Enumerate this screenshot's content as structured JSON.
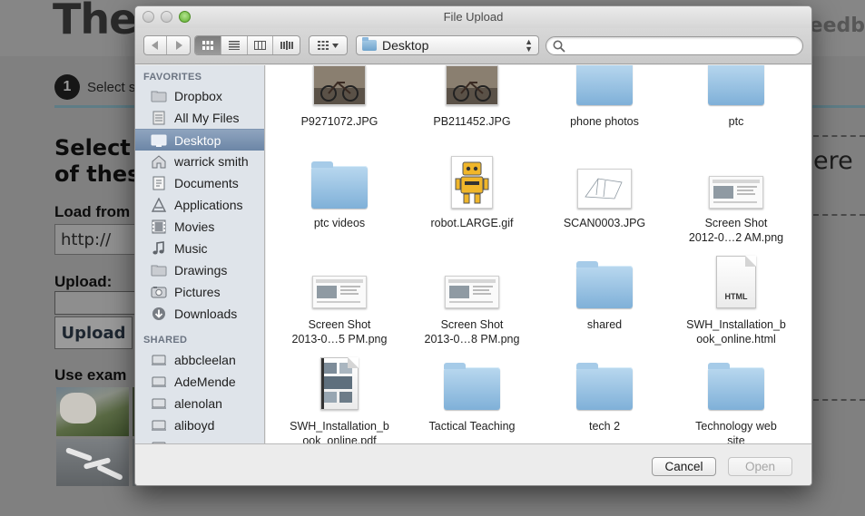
{
  "background_page": {
    "logo_text": "The",
    "feedback_text": "Feedb",
    "step_number": "1",
    "step_text": "Select s",
    "heading_line1": "Select",
    "heading_line2": "of thes",
    "right_text": "ere",
    "load_label": "Load from",
    "url_value": "http://",
    "upload_label": "Upload:",
    "upload_button": "Upload",
    "examples_label": "Use exam"
  },
  "dialog": {
    "title": "File Upload",
    "location": "Desktop",
    "search": {
      "value": "",
      "placeholder": ""
    },
    "sidebar": {
      "favorites_heading": "FAVORITES",
      "shared_heading": "SHARED",
      "favorites": [
        {
          "label": "Dropbox",
          "icon": "folder-icon"
        },
        {
          "label": "All My Files",
          "icon": "all-files-icon"
        },
        {
          "label": "Desktop",
          "icon": "desktop-icon",
          "selected": true
        },
        {
          "label": "warrick smith",
          "icon": "home-icon"
        },
        {
          "label": "Documents",
          "icon": "documents-icon"
        },
        {
          "label": "Applications",
          "icon": "applications-icon"
        },
        {
          "label": "Movies",
          "icon": "movies-icon"
        },
        {
          "label": "Music",
          "icon": "music-icon"
        },
        {
          "label": "Drawings",
          "icon": "folder-icon"
        },
        {
          "label": "Pictures",
          "icon": "pictures-icon"
        },
        {
          "label": "Downloads",
          "icon": "downloads-icon"
        }
      ],
      "shared": [
        {
          "label": "abbcleelan",
          "icon": "computer-icon"
        },
        {
          "label": "AdeMende",
          "icon": "computer-icon"
        },
        {
          "label": "alenolan",
          "icon": "computer-icon"
        },
        {
          "label": "aliboyd",
          "icon": "computer-icon"
        }
      ]
    },
    "files": [
      {
        "name": "P9271072.JPG",
        "kind": "photo"
      },
      {
        "name": "PB211452.JPG",
        "kind": "photo"
      },
      {
        "name": "phone photos",
        "kind": "folder"
      },
      {
        "name": "ptc",
        "kind": "folder"
      },
      {
        "name": "ptc videos",
        "kind": "folder"
      },
      {
        "name": "robot.LARGE.gif",
        "kind": "image"
      },
      {
        "name": "SCAN0003.JPG",
        "kind": "scan"
      },
      {
        "name": "Screen Shot 2012-0…2 AM.png",
        "line1": "Screen Shot",
        "line2": "2012-0…2 AM.png",
        "kind": "screenshot"
      },
      {
        "name": "Screen Shot 2013-0…5 PM.png",
        "line1": "Screen Shot",
        "line2": "2013-0…5 PM.png",
        "kind": "screenshot"
      },
      {
        "name": "Screen Shot 2013-0…8 PM.png",
        "line1": "Screen Shot",
        "line2": "2013-0…8 PM.png",
        "kind": "screenshot"
      },
      {
        "name": "shared",
        "kind": "folder"
      },
      {
        "name": "SWH_Installation_book_online.html",
        "line1": "SWH_Installation_b",
        "line2": "ook_online.html",
        "kind": "html",
        "tag": "HTML"
      },
      {
        "name": "SWH_Installation_book_online.pdf",
        "line1": "SWH_Installation_b",
        "line2": "ook_online.pdf",
        "kind": "pdf"
      },
      {
        "name": "Tactical Teaching",
        "kind": "folder"
      },
      {
        "name": "tech 2",
        "kind": "folder"
      },
      {
        "name": "Technology web site",
        "line1": "Technology web",
        "line2": "site",
        "kind": "folder"
      }
    ],
    "buttons": {
      "cancel": "Cancel",
      "open": "Open"
    }
  }
}
